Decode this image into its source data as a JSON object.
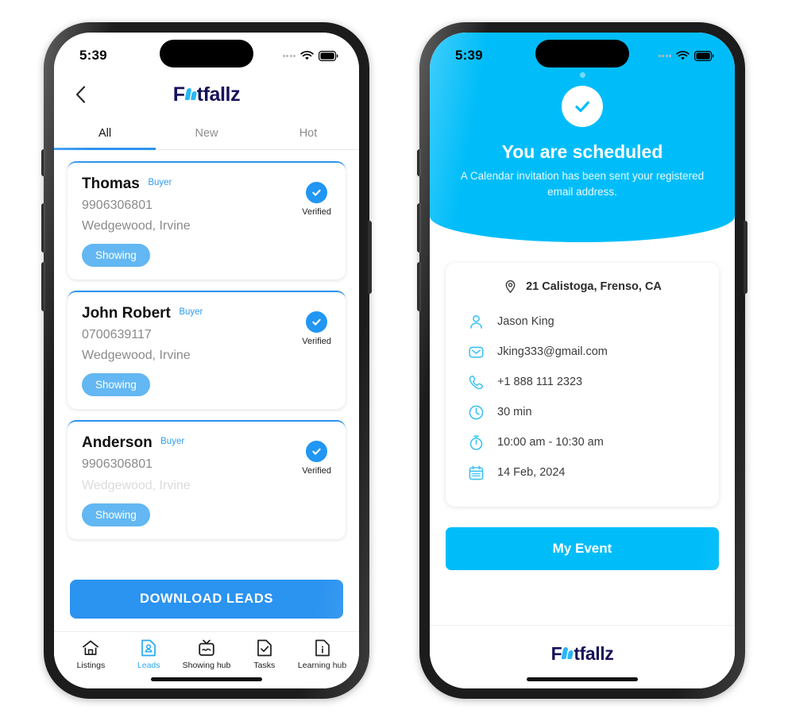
{
  "brand": {
    "name": "Footfallz",
    "name_prefix": "F",
    "name_suffix": "tfallz",
    "accent_blue": "#2b93f0",
    "cyan": "#00bdf9",
    "navy": "#18125a",
    "pill_blue": "#63b7f2",
    "verified_blue": "#2196f3"
  },
  "phone_left": {
    "status_bar": {
      "time": "5:39",
      "wifi": "wifi-icon",
      "battery": "battery-icon",
      "signal": "signal-dots-icon"
    },
    "header": {
      "back": "chevron-left-icon",
      "logo": "Footfallz"
    },
    "tabs": [
      {
        "label": "All",
        "active": true
      },
      {
        "label": "New",
        "active": false
      },
      {
        "label": "Hot",
        "active": false
      }
    ],
    "leads": [
      {
        "name": "Thomas",
        "type": "Buyer",
        "phone": "9906306801",
        "location": "Wedgewood, Irvine",
        "status": "Showing",
        "verified_label": "Verified"
      },
      {
        "name": "John Robert",
        "type": "Buyer",
        "phone": "0700639117",
        "location": "Wedgewood, Irvine",
        "status": "Showing",
        "verified_label": "Verified"
      },
      {
        "name": "Anderson",
        "type": "Buyer",
        "phone": "9906306801",
        "location": "Wedgewood, Irvine",
        "status": "Showing",
        "verified_label": "Verified"
      }
    ],
    "download_button": "DOWNLOAD LEADS",
    "tabbar": [
      {
        "label": "Listings",
        "icon": "home-icon",
        "active": false
      },
      {
        "label": "Leads",
        "icon": "lead-document-icon",
        "active": true
      },
      {
        "label": "Showing hub",
        "icon": "tv-icon",
        "active": false
      },
      {
        "label": "Tasks",
        "icon": "task-check-document-icon",
        "active": false
      },
      {
        "label": "Learning hub",
        "icon": "info-document-icon",
        "active": false
      }
    ]
  },
  "phone_right": {
    "status_bar": {
      "time": "5:39",
      "wifi": "wifi-icon",
      "battery": "battery-icon",
      "signal": "signal-dots-icon"
    },
    "hero": {
      "icon": "check-circle-icon",
      "title": "You are scheduled",
      "subtitle": "A Calendar invitation has been sent your registered email address."
    },
    "details": {
      "address": "21 Calistoga, Frenso, CA",
      "rows": [
        {
          "icon": "person-icon",
          "text": "Jason King"
        },
        {
          "icon": "envelope-icon",
          "text": "Jking333@gmail.com"
        },
        {
          "icon": "phone-icon",
          "text": "+1 888 111 2323"
        },
        {
          "icon": "clock-icon",
          "text": "30 min"
        },
        {
          "icon": "timer-icon",
          "text": "10:00 am - 10:30 am"
        },
        {
          "icon": "calendar-icon",
          "text": "14 Feb, 2024"
        }
      ]
    },
    "event_button": "My Event",
    "footer_logo": "Footfallz"
  }
}
